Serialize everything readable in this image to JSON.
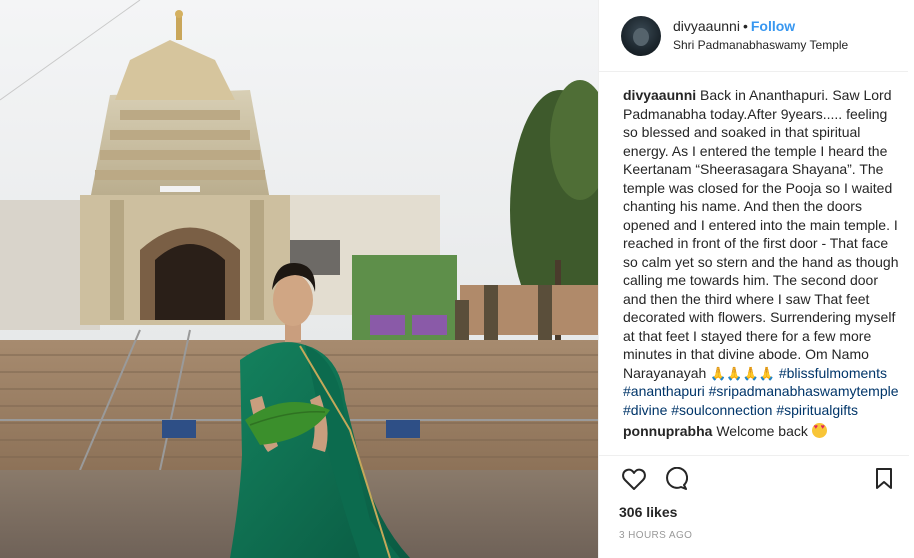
{
  "header": {
    "username": "divyaaunni",
    "separator": "•",
    "follow_label": "Follow",
    "location": "Shri Padmanabhaswamy Temple",
    "avatar_icon": "profile-photo"
  },
  "caption": {
    "username": "divyaaunni",
    "text": "Back in Ananthapuri. Saw Lord Padmanabha today.After 9years..... feeling so blessed and soaked in that spiritual energy. As I entered the temple I heard the Keertanam “Sheerasagara Shayana”. The temple was closed for the Pooja so I waited chanting his name. And then the doors opened and I entered into the main temple. I reached in front of the first door - That face so calm yet so stern and the hand as though calling me towards him. The second door and then the third where I saw That feet decorated with flowers. Surrendering myself at that feet I stayed there for a few more minutes in that divine abode. Om Namo Narayanayah",
    "emojis": "🙏🙏🙏🙏",
    "hashtags": [
      "#blissfulmoments",
      "#ananthapuri",
      "#sripadmanabhaswamytemple",
      "#divine",
      "#soulconnection",
      "#spiritualgifts"
    ]
  },
  "comments": [
    {
      "username": "ponnuprabha",
      "text": "Welcome back",
      "emoji": "heart-eyes"
    }
  ],
  "actions": {
    "like_icon": "heart-icon",
    "comment_icon": "comment-icon",
    "save_icon": "bookmark-icon",
    "likes": "306 likes",
    "timestamp": "3 HOURS AGO"
  },
  "colors": {
    "link": "#003569",
    "follow": "#3897f0",
    "border": "#efefef",
    "saree": "#0f6b4f"
  }
}
